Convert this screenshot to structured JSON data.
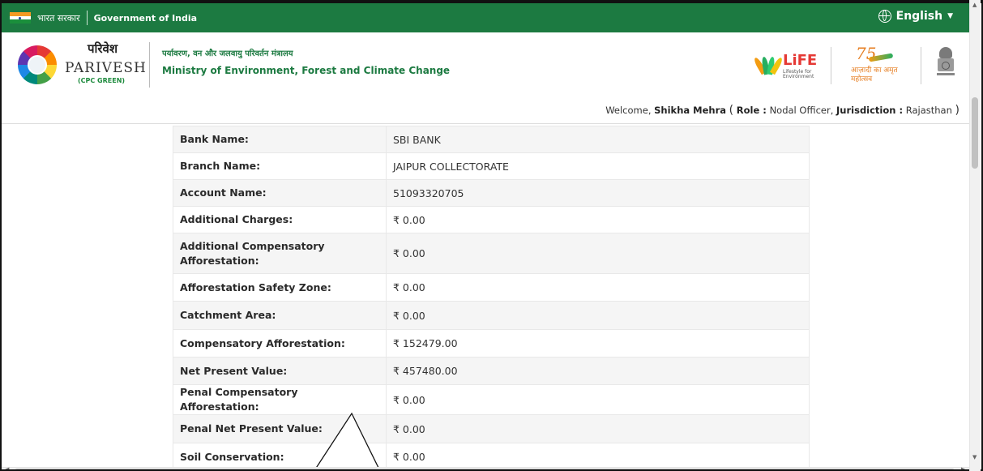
{
  "gov_bar": {
    "hindi_label": "भारत सरकार",
    "english_label": "Government of India",
    "language": "English"
  },
  "header": {
    "brand_hindi": "परिवेश",
    "brand_english": "PARIVESH",
    "brand_sub": "(CPC GREEN)",
    "ministry_hindi": "पर्यावरण, वन और जलवायु परिवर्तन मंत्रालय",
    "ministry_english": "Ministry of Environment, Forest and Climate Change",
    "life_title": "LiFE",
    "life_sub": "Lifestyle for Environment",
    "azadi_num": "75",
    "azadi_text": "आज़ादी का अमृत महोत्सव"
  },
  "welcome": {
    "prefix": "Welcome,",
    "user": "Shikha Mehra",
    "role_label": "Role :",
    "role": "Nodal Officer,",
    "jurisdiction_label": "Jurisdiction :",
    "jurisdiction": "Rajasthan"
  },
  "details": [
    {
      "label": "Bank Name:",
      "value": "SBI BANK"
    },
    {
      "label": "Branch Name:",
      "value": "JAIPUR COLLECTORATE"
    },
    {
      "label": "Account Name:",
      "value": "51093320705"
    },
    {
      "label": "Additional Charges:",
      "value": "₹ 0.00"
    },
    {
      "label": "Additional Compensatory Afforestation:",
      "value": "₹ 0.00"
    },
    {
      "label": "Afforestation Safety Zone:",
      "value": "₹ 0.00"
    },
    {
      "label": "Catchment Area:",
      "value": "₹ 0.00"
    },
    {
      "label": "Compensatory Afforestation:",
      "value": "₹ 152479.00"
    },
    {
      "label": "Net Present Value:",
      "value": "₹ 457480.00"
    },
    {
      "label": "Penal Compensatory Afforestation:",
      "value": "₹ 0.00"
    },
    {
      "label": "Penal Net Present Value:",
      "value": "₹ 0.00"
    },
    {
      "label": "Soil Conservation:",
      "value": "₹ 0.00"
    }
  ],
  "colors": {
    "gov_bar": "#1c7a41",
    "ministry_text": "#1c7a41",
    "row_shade": "#f5f5f5"
  }
}
